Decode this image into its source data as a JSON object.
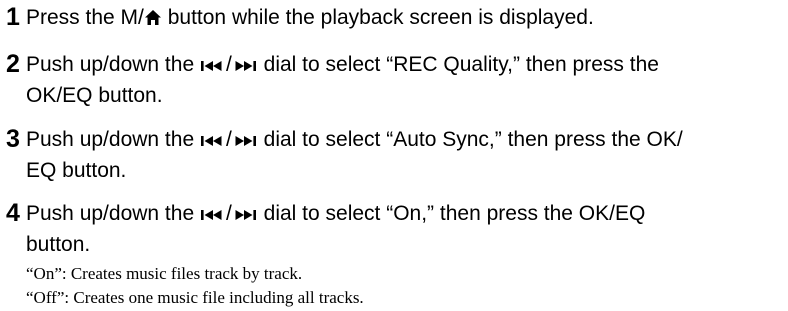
{
  "steps": [
    {
      "number": "1",
      "line1_before": "Press the M",
      "separator": "/",
      "line1_after": " button while the playback screen is displayed.",
      "icons": [
        "home-icon"
      ]
    },
    {
      "number": "2",
      "line1_before": "Push up/down the ",
      "line1_after": " dial to select “REC Quality,” then press the",
      "line2": "OK/EQ button.",
      "icons": [
        "previous-track-icon",
        "next-track-icon"
      ]
    },
    {
      "number": "3",
      "line1_before": "Push up/down the ",
      "line1_after": " dial to select “Auto Sync,” then press the OK/",
      "line2": "EQ button.",
      "icons": [
        "previous-track-icon",
        "next-track-icon"
      ]
    },
    {
      "number": "4",
      "line1_before": "Push up/down the ",
      "line1_after": " dial to select “On,” then press the OK/EQ",
      "line2": "button.",
      "icons": [
        "previous-track-icon",
        "next-track-icon"
      ]
    }
  ],
  "dial_separator": "/",
  "notes": [
    "“On”: Creates music files track by track.",
    "“Off”: Creates one music file including all tracks."
  ]
}
